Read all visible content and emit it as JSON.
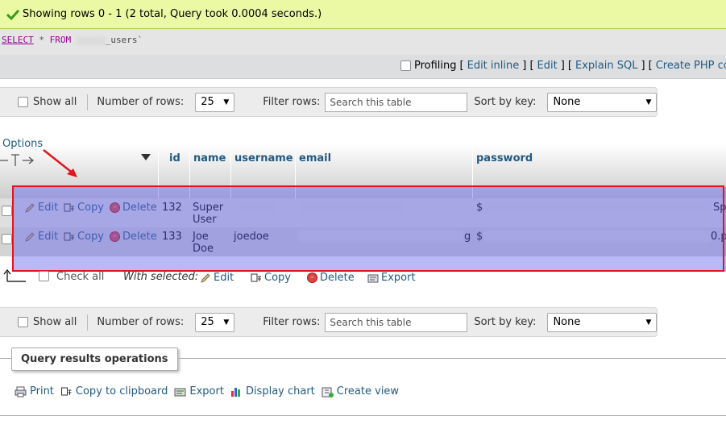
{
  "success": {
    "message": "Showing rows 0 - 1 (2 total, Query took 0.0004 seconds.)",
    "icon": "checkmark-icon"
  },
  "sql": {
    "select": "SELECT",
    "star": "*",
    "from": "FROM",
    "table_suffix": "_users`"
  },
  "profiling": {
    "label": "Profiling",
    "links": [
      "Edit inline",
      "Edit",
      "Explain SQL",
      "Create PHP code"
    ],
    "open_bracket": "[",
    "close_bracket": "]",
    "sep": "] [",
    "trailing": "| ["
  },
  "nav": {
    "show_all": "Show all",
    "number_of_rows_label": "Number of rows:",
    "number_of_rows_value": "25",
    "filter_label": "Filter rows:",
    "filter_placeholder": "Search this table",
    "sort_label": "Sort by key:",
    "sort_value": "None"
  },
  "table": {
    "options_label": "Options",
    "columns": [
      "id",
      "name",
      "username",
      "email",
      "password"
    ],
    "actions": {
      "edit": "Edit",
      "copy": "Copy",
      "delete": "Delete"
    },
    "rows": [
      {
        "id": "132",
        "name_line1": "Super",
        "name_line2": "User",
        "username": "",
        "email": "",
        "password_prefix": "$",
        "password_suffix": "Sp"
      },
      {
        "id": "133",
        "name_line1": "Joe",
        "name_line2": "Doe",
        "username": "joedoe",
        "email": "g",
        "password_prefix": "$",
        "password_suffix": "0.p"
      }
    ]
  },
  "bulk": {
    "check_all": "Check all",
    "with_selected": "With selected:",
    "edit": "Edit",
    "copy": "Copy",
    "delete": "Delete",
    "export": "Export"
  },
  "operations": {
    "title": "Query results operations",
    "items": [
      "Print",
      "Copy to clipboard",
      "Export",
      "Display chart",
      "Create view"
    ]
  },
  "colors": {
    "accent_link": "#235a81",
    "success_bg": "#ebf8a4",
    "highlight_border": "#e3141d",
    "highlight_fill": "#6464f0"
  }
}
